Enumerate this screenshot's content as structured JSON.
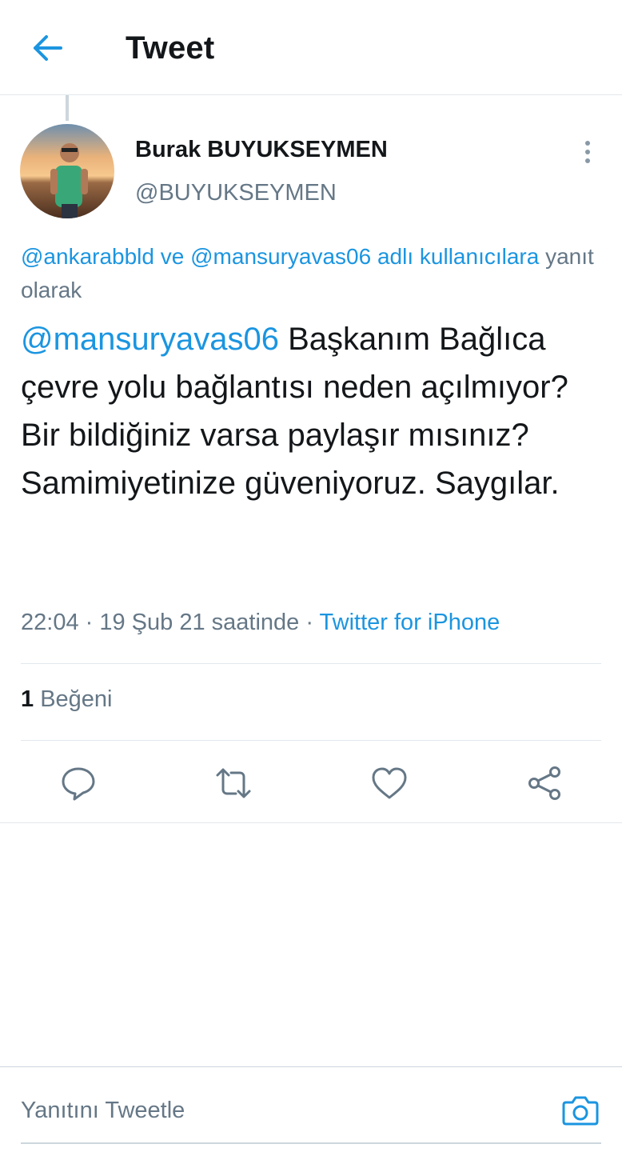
{
  "header": {
    "title": "Tweet",
    "back_icon": "arrow-left-icon"
  },
  "tweet": {
    "author_name": "Burak BUYUKSEYMEN",
    "author_handle": "@BUYUKSEYMEN",
    "reply_context": {
      "mention1": "@ankarabbld",
      "connector": " ve ",
      "mention2": "@mansuryavas06",
      "suffix_link": " adlı kullanıcılara",
      "suffix_text": " yanıt olarak"
    },
    "mention": "@mansuryavas06",
    "text": " Başkanım Bağlıca çevre yolu bağlantısı neden açılmıyor? Bir bildiğiniz varsa paylaşır mısınız? Samimiyetinize güveniyoruz. Saygılar.",
    "time": "22:04",
    "date": "19 Şub 21 saatinde",
    "separator": " · ",
    "source": "Twitter for iPhone",
    "likes_count": "1",
    "likes_label": "Beğeni"
  },
  "actions": {
    "icons": [
      "reply-icon",
      "retweet-icon",
      "like-icon",
      "share-icon"
    ]
  },
  "reply_bar": {
    "placeholder": "Yanıtını Tweetle",
    "camera_icon": "camera-icon"
  },
  "colors": {
    "accent": "#1b95e0",
    "text": "#14171a",
    "secondary": "#657786",
    "border": "#e1e8ed"
  }
}
